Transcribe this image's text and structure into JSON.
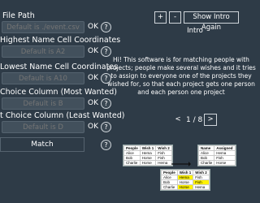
{
  "settings": {
    "fields": [
      {
        "label": "File Path",
        "placeholder": "Default is ./event.csv",
        "ok": "OK",
        "help": "?"
      },
      {
        "label": "Highest Name Cell Coordinates",
        "placeholder": "Default is A2",
        "ok": "OK",
        "help": "?"
      },
      {
        "label": "Lowest Name Cell Coordinates",
        "placeholder": "Default is A10",
        "ok": "OK",
        "help": "?"
      },
      {
        "label": "Choice Column (Most Wanted)",
        "placeholder": "Default is B",
        "ok": "OK",
        "help": "?"
      },
      {
        "label": "t Choice Column (Least Wanted)",
        "placeholder": "Default is D",
        "ok": "OK",
        "help": "?"
      }
    ],
    "match_label": "Match",
    "match_help": "?"
  },
  "intro": {
    "plus": "+",
    "minus": "-",
    "show_intro_again": "Show Intro Again",
    "title": "Intro",
    "line1": "Hi! This software is for matching people with",
    "line2": "projects; people make several wishes and it tries",
    "line3": "to assign to everyone one of the projects they",
    "line4": "wished for, so that each project gets one person",
    "line5": "and each person one project",
    "prev": "<",
    "page": "1 / 8",
    "next": ">"
  },
  "example": {
    "input_sheet": {
      "header": [
        "People",
        "Wish 1",
        "Wish 2"
      ],
      "rows": [
        [
          "Alice",
          "Hema",
          "Fish"
        ],
        [
          "Bob",
          "Horse",
          "Fish"
        ],
        [
          "Charlie",
          "Horse",
          "Hema"
        ]
      ]
    },
    "input_sheet_copy": {
      "header": [
        "People",
        "Wish 1",
        "Wish 2"
      ],
      "rows": [
        [
          "Alice",
          "Hema",
          "Fish"
        ],
        [
          "Bob",
          "Horse",
          "Fish"
        ],
        [
          "Charlie",
          "Horse",
          "Hema"
        ]
      ]
    },
    "output_sheet": {
      "header": [
        "Name",
        "Assigned"
      ],
      "rows": [
        [
          "Alice",
          "Hema"
        ],
        [
          "Bob",
          "Fish"
        ],
        [
          "Charlie",
          "Horse"
        ]
      ]
    }
  }
}
